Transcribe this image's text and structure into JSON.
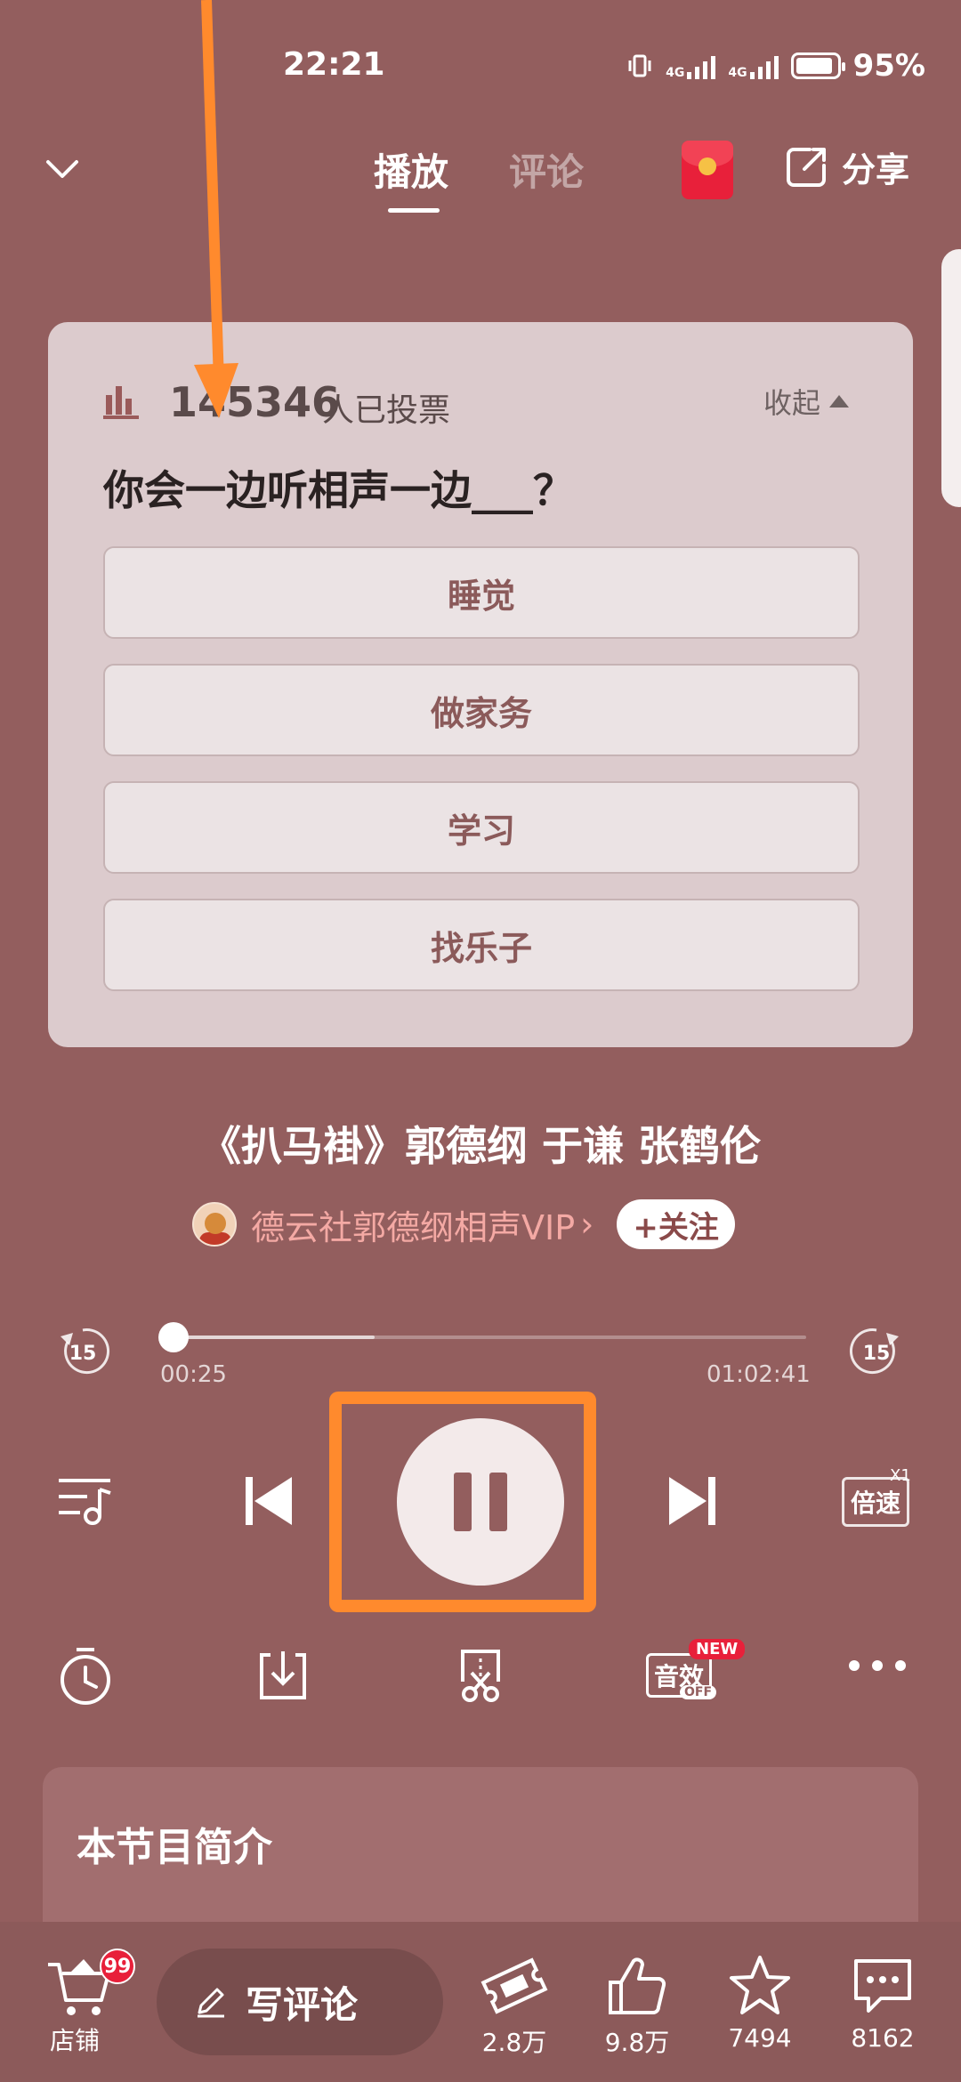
{
  "status_bar": {
    "time": "22:21",
    "net1": "4G",
    "net2": "4G",
    "battery": "95%"
  },
  "nav": {
    "tab_play": "播放",
    "tab_comment": "评论",
    "share_label": "分享"
  },
  "poll": {
    "count": "145346",
    "count_suffix": "人已投票",
    "collapse_label": "收起",
    "question": "你会一边听相声一边___？",
    "options": [
      {
        "label": "睡觉"
      },
      {
        "label": "做家务"
      },
      {
        "label": "学习"
      },
      {
        "label": "找乐子"
      }
    ]
  },
  "track": {
    "title": "《扒马褂》郭德纲 于谦 张鹤伦",
    "author": "德云社郭德纲相声VIP",
    "author_arrow": "›",
    "follow_label": "+关注"
  },
  "player": {
    "skip_back_label": "15",
    "skip_forward_label": "15",
    "current_time": "00:25",
    "total_time": "01:02:41",
    "progress": 0.0066,
    "buffered": 0.33,
    "speed_label": "倍速",
    "speed_value": "X1"
  },
  "tools": {
    "sound_label": "音效",
    "sound_new_badge": "NEW",
    "sound_off_badge": "OFF"
  },
  "intro": {
    "title": "本节目简介"
  },
  "bottom": {
    "shop_label": "店铺",
    "shop_badge": "99",
    "comment_placeholder": "写评论",
    "ticket_count": "2.8万",
    "like_count": "9.8万",
    "fav_count": "7494",
    "comment_count": "8162"
  },
  "colors": {
    "background": "#935e5e",
    "highlight": "#ff8a2d",
    "accent_red": "#e8203a"
  }
}
